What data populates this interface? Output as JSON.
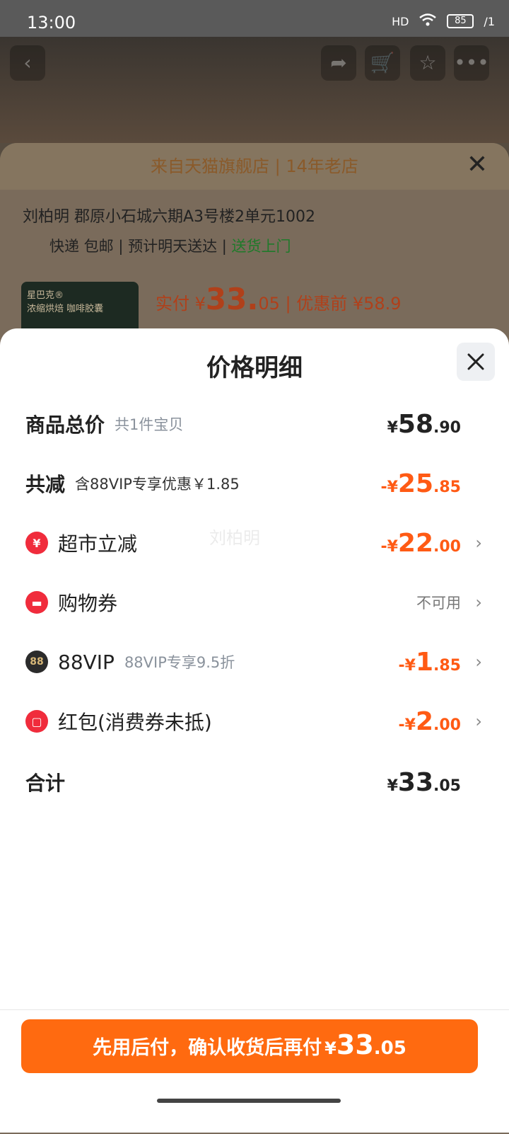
{
  "status_bar": {
    "time": "13:00",
    "signal": "HD",
    "battery": "85",
    "extra": "/1"
  },
  "background": {
    "store_banner": "来自天猫旗舰店 | 14年老店",
    "address": "刘柏明 郡原小石城六期A3号楼2单元1002",
    "delivery": "快递 包邮 | 预计明天送达 |",
    "delivery_tag": "送货上门",
    "product_brand": "星巴克®",
    "product_name": "浓缩烘焙 咖啡胶囊",
    "paid_label": "实付 ¥",
    "paid_int": "33.",
    "paid_dec": "05",
    "before_label": "| 优惠前 ¥58.9"
  },
  "sheet": {
    "title": "价格明细",
    "watermark": "刘柏明",
    "rows": [
      {
        "label": "商品总价",
        "sub": "共1件宝贝",
        "cur": "¥",
        "int": "58",
        "dec": ".90"
      },
      {
        "label": "共减",
        "sub": "含88VIP专享优惠￥1.85",
        "cur": "-¥",
        "int": "25",
        "dec": ".85"
      },
      {
        "label": "超市立减",
        "cur": "-¥",
        "int": "22",
        "dec": ".00"
      },
      {
        "label": "购物券",
        "status": "不可用"
      },
      {
        "label": "88VIP",
        "sub": "88VIP专享9.5折",
        "cur": "-¥",
        "int": "1",
        "dec": ".85"
      },
      {
        "label": "红包(消费券未抵)",
        "cur": "-¥",
        "int": "2",
        "dec": ".00"
      },
      {
        "label": "合计",
        "cur": "¥",
        "int": "33",
        "dec": ".05"
      }
    ]
  },
  "icons": {
    "discount": "yen-icon",
    "coupon": "ticket-icon",
    "vip": "vip88-icon",
    "redpacket": "red-packet-icon"
  },
  "footer": {
    "button_text": "先用后付，确认收货后再付",
    "cur": "¥",
    "int": "33",
    "dec": ".05"
  },
  "colors": {
    "accent": "#ff6a10",
    "discount": "#ff5a14",
    "red_icon": "#f02c3c"
  }
}
